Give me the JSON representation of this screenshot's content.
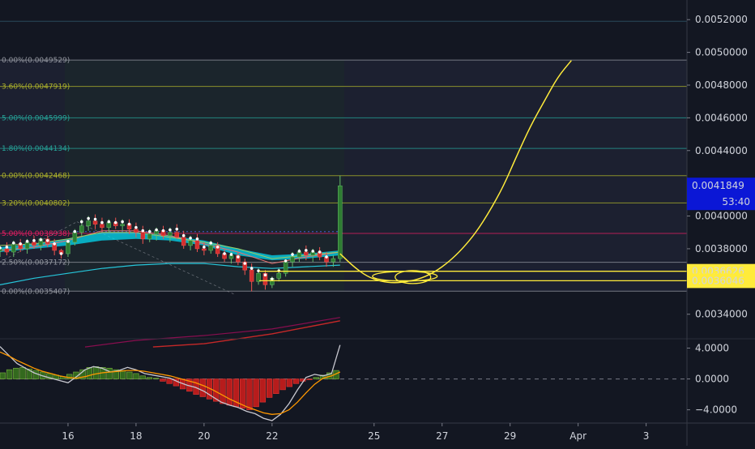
{
  "chart_data": {
    "type": "candlestick",
    "grid": false,
    "price_axis": {
      "ticks": [
        "0.0052000",
        "0.0050000",
        "0.0048000",
        "0.0046000",
        "0.0044000",
        "0.0042000",
        "0.0040000",
        "0.0038000",
        "0.0036000",
        "0.0034000"
      ],
      "tick_values": [
        0.0052,
        0.005,
        0.0048,
        0.0046,
        0.0044,
        0.0042,
        0.004,
        0.0038,
        0.0036,
        0.0034
      ],
      "range": [
        0.00325,
        0.00532
      ]
    },
    "price_badges": [
      {
        "label": "0.0041849",
        "value": 0.0041849,
        "color": "#0b17d6",
        "text_color": "#ffffff"
      },
      {
        "label": "53:40",
        "color": "#0b17d6",
        "text_color": "#ffffff"
      },
      {
        "label": "0.0036626",
        "value": 0.0036626,
        "color": "#ffeb3b",
        "text_color": "#000000"
      },
      {
        "label": "0.0036046",
        "value": 0.0036046,
        "color": "#ffeb3b",
        "text_color": "#000000"
      }
    ],
    "time_axis": {
      "labels": [
        "16",
        "18",
        "20",
        "22",
        "25",
        "27",
        "29",
        "Apr",
        "3"
      ],
      "positions": [
        16,
        18,
        20,
        22,
        25,
        27,
        29,
        31,
        33
      ]
    },
    "fib_levels": [
      {
        "label": "0.00%(0.0049529)",
        "value": 0.0049529,
        "color": "#9598a1"
      },
      {
        "label": "3.60%(0.0047919)",
        "value": 0.0047919,
        "color": "#afb42b"
      },
      {
        "label": "5.00%(0.0045999)",
        "value": 0.0045999,
        "color": "#26a69a"
      },
      {
        "label": "1.80%(0.0044134)",
        "value": 0.0044134,
        "color": "#26a69a"
      },
      {
        "label": "0.00%(0.0042468)",
        "value": 0.0042468,
        "color": "#afb42b"
      },
      {
        "label": "3.20%(0.0040802)",
        "value": 0.0040802,
        "color": "#afb42b"
      },
      {
        "label": "5.00%(0.0038938)",
        "value": 0.0038938,
        "color": "#e91e63"
      },
      {
        "label": "2.50%(0.0037172)",
        "value": 0.0037172,
        "color": "#9598a1"
      },
      {
        "label": "0.00%(0.0035407)",
        "value": 0.0035407,
        "color": "#9598a1"
      }
    ],
    "horizontal_lines": [
      {
        "value": 0.0036626,
        "color": "#ffeb3b"
      },
      {
        "value": 0.0036046,
        "color": "#ffeb3b"
      }
    ],
    "candles": [
      {
        "t": 14.0,
        "o": 0.003785,
        "h": 0.00382,
        "l": 0.00375,
        "c": 0.0038
      },
      {
        "t": 14.2,
        "o": 0.0038,
        "h": 0.00384,
        "l": 0.00376,
        "c": 0.00378
      },
      {
        "t": 14.4,
        "o": 0.00378,
        "h": 0.00385,
        "l": 0.00375,
        "c": 0.00383
      },
      {
        "t": 14.6,
        "o": 0.00383,
        "h": 0.00386,
        "l": 0.00378,
        "c": 0.0038
      },
      {
        "t": 14.8,
        "o": 0.0038,
        "h": 0.00386,
        "l": 0.00377,
        "c": 0.00384
      },
      {
        "t": 15.0,
        "o": 0.00384,
        "h": 0.00388,
        "l": 0.0038,
        "c": 0.00382
      },
      {
        "t": 15.2,
        "o": 0.00382,
        "h": 0.00387,
        "l": 0.00379,
        "c": 0.00386
      },
      {
        "t": 15.4,
        "o": 0.00386,
        "h": 0.00388,
        "l": 0.00381,
        "c": 0.00383
      },
      {
        "t": 15.6,
        "o": 0.00383,
        "h": 0.00386,
        "l": 0.00376,
        "c": 0.00379
      },
      {
        "t": 15.8,
        "o": 0.00379,
        "h": 0.0038,
        "l": 0.00374,
        "c": 0.00377
      },
      {
        "t": 16.0,
        "o": 0.00377,
        "h": 0.00386,
        "l": 0.00375,
        "c": 0.00384
      },
      {
        "t": 16.2,
        "o": 0.00384,
        "h": 0.00392,
        "l": 0.00382,
        "c": 0.0039
      },
      {
        "t": 16.4,
        "o": 0.0039,
        "h": 0.00398,
        "l": 0.00388,
        "c": 0.00394
      },
      {
        "t": 16.6,
        "o": 0.00394,
        "h": 0.004,
        "l": 0.00391,
        "c": 0.00397
      },
      {
        "t": 16.8,
        "o": 0.00397,
        "h": 0.00401,
        "l": 0.00392,
        "c": 0.00395
      },
      {
        "t": 17.0,
        "o": 0.00395,
        "h": 0.00399,
        "l": 0.0039,
        "c": 0.00393
      },
      {
        "t": 17.2,
        "o": 0.00393,
        "h": 0.00398,
        "l": 0.0039,
        "c": 0.00396
      },
      {
        "t": 17.4,
        "o": 0.00396,
        "h": 0.00399,
        "l": 0.00392,
        "c": 0.00394
      },
      {
        "t": 17.6,
        "o": 0.00394,
        "h": 0.00398,
        "l": 0.00391,
        "c": 0.00395
      },
      {
        "t": 17.8,
        "o": 0.00395,
        "h": 0.00398,
        "l": 0.00389,
        "c": 0.00392
      },
      {
        "t": 18.0,
        "o": 0.00392,
        "h": 0.00396,
        "l": 0.00387,
        "c": 0.0039
      },
      {
        "t": 18.2,
        "o": 0.0039,
        "h": 0.00394,
        "l": 0.00383,
        "c": 0.00386
      },
      {
        "t": 18.4,
        "o": 0.00386,
        "h": 0.00392,
        "l": 0.00384,
        "c": 0.00389
      },
      {
        "t": 18.6,
        "o": 0.00389,
        "h": 0.00393,
        "l": 0.00385,
        "c": 0.00391
      },
      {
        "t": 18.8,
        "o": 0.00391,
        "h": 0.00394,
        "l": 0.00386,
        "c": 0.00388
      },
      {
        "t": 19.0,
        "o": 0.00388,
        "h": 0.00393,
        "l": 0.00384,
        "c": 0.0039
      },
      {
        "t": 19.2,
        "o": 0.0039,
        "h": 0.00395,
        "l": 0.00386,
        "c": 0.00387
      },
      {
        "t": 19.4,
        "o": 0.00387,
        "h": 0.00391,
        "l": 0.0038,
        "c": 0.00382
      },
      {
        "t": 19.6,
        "o": 0.00382,
        "h": 0.00388,
        "l": 0.00379,
        "c": 0.00385
      },
      {
        "t": 19.8,
        "o": 0.00385,
        "h": 0.00389,
        "l": 0.00378,
        "c": 0.0038
      },
      {
        "t": 20.0,
        "o": 0.0038,
        "h": 0.00384,
        "l": 0.00376,
        "c": 0.00379
      },
      {
        "t": 20.2,
        "o": 0.00379,
        "h": 0.00385,
        "l": 0.00377,
        "c": 0.00382
      },
      {
        "t": 20.4,
        "o": 0.00382,
        "h": 0.00384,
        "l": 0.00375,
        "c": 0.00377
      },
      {
        "t": 20.6,
        "o": 0.00377,
        "h": 0.0038,
        "l": 0.00372,
        "c": 0.00374
      },
      {
        "t": 20.8,
        "o": 0.00374,
        "h": 0.00378,
        "l": 0.00371,
        "c": 0.00376
      },
      {
        "t": 21.0,
        "o": 0.00376,
        "h": 0.00378,
        "l": 0.0037,
        "c": 0.00372
      },
      {
        "t": 21.2,
        "o": 0.00372,
        "h": 0.00374,
        "l": 0.00364,
        "c": 0.00367
      },
      {
        "t": 21.4,
        "o": 0.00367,
        "h": 0.00371,
        "l": 0.00354,
        "c": 0.0036
      },
      {
        "t": 21.6,
        "o": 0.0036,
        "h": 0.00368,
        "l": 0.00358,
        "c": 0.00365
      },
      {
        "t": 21.8,
        "o": 0.00365,
        "h": 0.00367,
        "l": 0.00355,
        "c": 0.00358
      },
      {
        "t": 22.0,
        "o": 0.00358,
        "h": 0.00363,
        "l": 0.00356,
        "c": 0.00362
      },
      {
        "t": 22.2,
        "o": 0.00362,
        "h": 0.00368,
        "l": 0.0036,
        "c": 0.00365
      },
      {
        "t": 22.4,
        "o": 0.00365,
        "h": 0.00374,
        "l": 0.00363,
        "c": 0.00372
      },
      {
        "t": 22.6,
        "o": 0.00372,
        "h": 0.00378,
        "l": 0.00369,
        "c": 0.00375
      },
      {
        "t": 22.8,
        "o": 0.00375,
        "h": 0.0038,
        "l": 0.00372,
        "c": 0.00378
      },
      {
        "t": 23.0,
        "o": 0.00378,
        "h": 0.00382,
        "l": 0.00373,
        "c": 0.00376
      },
      {
        "t": 23.2,
        "o": 0.00376,
        "h": 0.0038,
        "l": 0.00372,
        "c": 0.00378
      },
      {
        "t": 23.4,
        "o": 0.00378,
        "h": 0.00381,
        "l": 0.00373,
        "c": 0.00375
      },
      {
        "t": 23.6,
        "o": 0.00375,
        "h": 0.00378,
        "l": 0.00369,
        "c": 0.00372
      },
      {
        "t": 23.8,
        "o": 0.00372,
        "h": 0.00376,
        "l": 0.00369,
        "c": 0.00374
      },
      {
        "t": 24.0,
        "o": 0.00374,
        "h": 0.0042468,
        "l": 0.00372,
        "c": 0.0041849
      }
    ],
    "moving_averages": [
      {
        "color": "#26c6da",
        "width": 1.2,
        "points": [
          [
            14.0,
            0.00358
          ],
          [
            15.0,
            0.00362
          ],
          [
            16.0,
            0.00365
          ],
          [
            17.0,
            0.00368
          ],
          [
            18.0,
            0.0037
          ],
          [
            19.0,
            0.00371
          ],
          [
            20.0,
            0.00371
          ],
          [
            21.0,
            0.00369
          ],
          [
            22.0,
            0.00368
          ],
          [
            23.0,
            0.00369
          ],
          [
            24.0,
            0.0037
          ]
        ]
      },
      {
        "color": "#880e4f",
        "width": 1.2,
        "points": [
          [
            16.5,
            0.0032
          ],
          [
            18.0,
            0.00324
          ],
          [
            20.0,
            0.00327
          ],
          [
            22.0,
            0.00331
          ],
          [
            24.0,
            0.00338
          ]
        ]
      },
      {
        "color": "#c62828",
        "width": 1.4,
        "points": [
          [
            18.5,
            0.0032
          ],
          [
            20.0,
            0.00322
          ],
          [
            22.0,
            0.00328
          ],
          [
            24.0,
            0.00336
          ]
        ]
      },
      {
        "color": "#e57373",
        "width": 1.0,
        "points": [
          [
            14.0,
            0.00379
          ],
          [
            15.0,
            0.00381
          ],
          [
            16.0,
            0.00385
          ],
          [
            17.0,
            0.00391
          ],
          [
            18.0,
            0.00391
          ],
          [
            19.0,
            0.00388
          ],
          [
            20.0,
            0.00383
          ],
          [
            21.0,
            0.00378
          ],
          [
            22.0,
            0.00371
          ],
          [
            23.0,
            0.00375
          ],
          [
            24.0,
            0.00378
          ]
        ]
      },
      {
        "color": "#9ccc65",
        "width": 1.0,
        "points": [
          [
            14.0,
            0.00382
          ],
          [
            15.0,
            0.00383
          ],
          [
            16.0,
            0.00386
          ],
          [
            17.0,
            0.0039
          ],
          [
            18.0,
            0.0039
          ],
          [
            19.0,
            0.00387
          ],
          [
            20.0,
            0.00384
          ],
          [
            21.0,
            0.0038
          ],
          [
            22.0,
            0.00374
          ],
          [
            23.0,
            0.00376
          ],
          [
            24.0,
            0.00378
          ]
        ]
      }
    ],
    "ma_ribbon": {
      "color": "#00e5ff",
      "points": [
        [
          14.0,
          0.00378,
          0.00381
        ],
        [
          15.0,
          0.0038,
          0.00383
        ],
        [
          16.0,
          0.00382,
          0.00386
        ],
        [
          17.0,
          0.00385,
          0.0039
        ],
        [
          18.0,
          0.00386,
          0.0039
        ],
        [
          19.0,
          0.00385,
          0.00388
        ],
        [
          20.0,
          0.00382,
          0.00385
        ],
        [
          21.0,
          0.00376,
          0.0038
        ],
        [
          22.0,
          0.00373,
          0.00376
        ],
        [
          23.0,
          0.00374,
          0.00377
        ],
        [
          24.0,
          0.00376,
          0.00379
        ]
      ]
    },
    "projection": {
      "color": "#ffeb3b",
      "points": [
        [
          24.0,
          0.00377
        ],
        [
          24.4,
          0.00369
        ],
        [
          24.8,
          0.00363
        ],
        [
          25.2,
          0.0036
        ],
        [
          25.6,
          0.00359
        ],
        [
          26.0,
          0.0036
        ],
        [
          26.4,
          0.00362
        ],
        [
          26.8,
          0.00366
        ],
        [
          27.2,
          0.00372
        ],
        [
          27.6,
          0.0038
        ],
        [
          28.0,
          0.0039
        ],
        [
          28.4,
          0.00403
        ],
        [
          28.8,
          0.00418
        ],
        [
          29.2,
          0.00437
        ],
        [
          29.6,
          0.00455
        ],
        [
          30.0,
          0.0047
        ],
        [
          30.4,
          0.00485
        ],
        [
          30.8,
          0.00495
        ]
      ]
    },
    "oscillator": {
      "ticks": [
        "4.0000",
        "0.0000",
        "−4.0000"
      ],
      "tick_values": [
        4,
        0,
        -4
      ],
      "range": [
        -5.3,
        5
      ],
      "histogram": [
        0.8,
        1.2,
        1.4,
        1.5,
        1.3,
        1.1,
        0.9,
        0.7,
        0.5,
        0.3,
        0.6,
        0.9,
        1.2,
        1.5,
        1.6,
        1.5,
        1.4,
        1.2,
        1.1,
        0.9,
        0.7,
        0.4,
        0.2,
        0.1,
        -0.3,
        -0.6,
        -0.9,
        -1.3,
        -1.6,
        -2.0,
        -2.3,
        -2.6,
        -2.9,
        -3.2,
        -3.4,
        -3.6,
        -3.8,
        -4.0,
        -3.6,
        -3.0,
        -2.4,
        -1.9,
        -1.4,
        -1.0,
        -0.6,
        -0.3,
        -0.1,
        0.2,
        0.5,
        0.8,
        1.1
      ],
      "macd": [
        4.2,
        3.1,
        2.0,
        1.4,
        0.8,
        0.4,
        0.1,
        -0.2,
        -0.5,
        0.3,
        1.2,
        1.6,
        1.4,
        0.9,
        1.1,
        1.5,
        1.2,
        0.7,
        0.5,
        0.3,
        0.1,
        -0.4,
        -0.8,
        -1.1,
        -1.6,
        -2.3,
        -3.0,
        -3.4,
        -3.7,
        -4.2,
        -4.5,
        -5.1,
        -5.4,
        -4.6,
        -3.2,
        -1.4,
        0.2,
        0.6,
        0.4,
        0.7,
        4.4
      ],
      "signal": [
        3.5,
        3.0,
        2.4,
        1.9,
        1.4,
        1.0,
        0.7,
        0.4,
        0.2,
        0.1,
        0.3,
        0.6,
        0.8,
        0.9,
        1.0,
        1.1,
        1.1,
        1.0,
        0.8,
        0.6,
        0.4,
        0.1,
        -0.2,
        -0.5,
        -0.9,
        -1.4,
        -2.0,
        -2.6,
        -3.1,
        -3.6,
        -4.0,
        -4.4,
        -4.6,
        -4.5,
        -4.0,
        -3.0,
        -1.8,
        -0.7,
        0.1,
        0.4,
        0.9
      ],
      "macd_color": "#c8c8d0",
      "signal_color": "#ff9800"
    }
  }
}
